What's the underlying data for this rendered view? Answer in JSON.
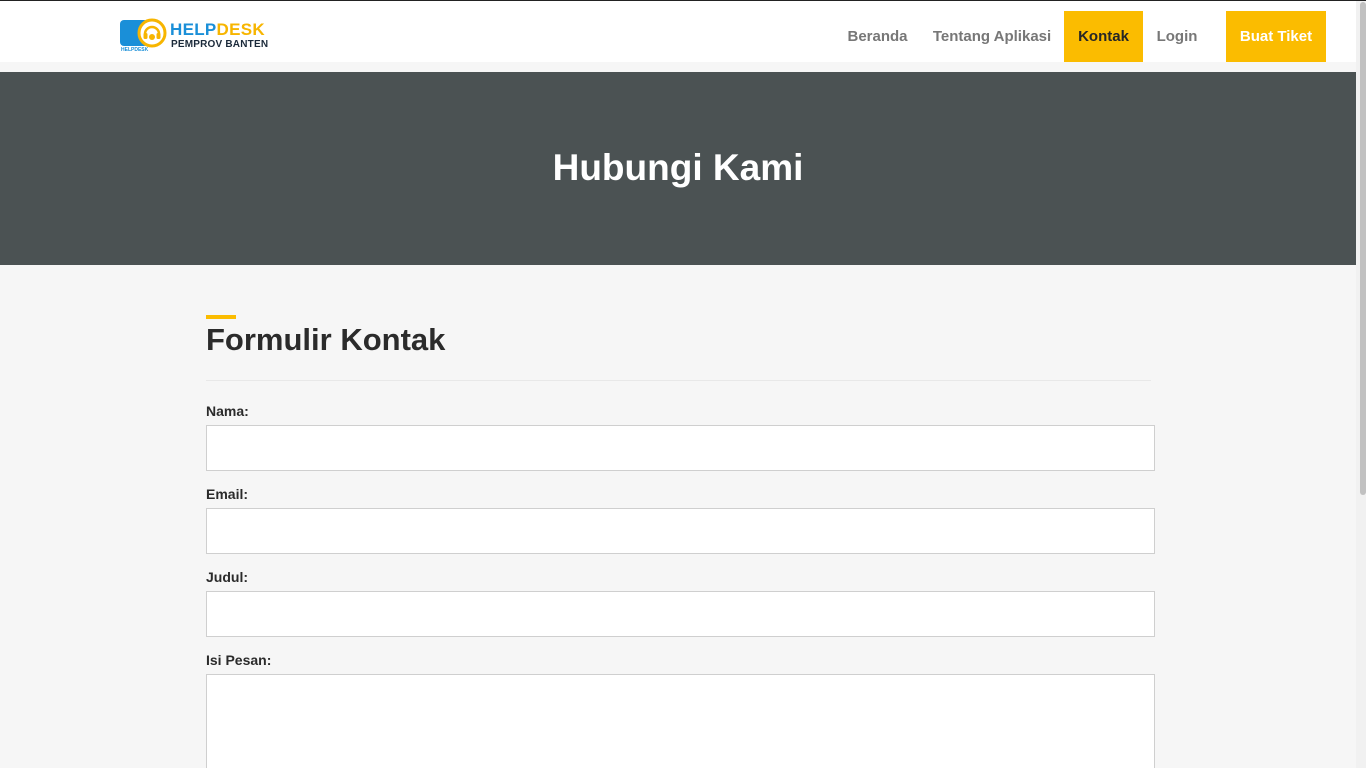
{
  "logo": {
    "title_help": "HELP",
    "title_desk": "DESK",
    "subtitle": "PEMPROV BANTEN",
    "mini_text": "HELPDESK",
    "icon": "headset-icon"
  },
  "nav": {
    "items": [
      {
        "label": "Beranda"
      },
      {
        "label": "Tentang Aplikasi"
      },
      {
        "label": "Kontak",
        "active": true
      },
      {
        "label": "Login"
      }
    ],
    "cta_label": "Buat Tiket"
  },
  "hero": {
    "title": "Hubungi Kami"
  },
  "form": {
    "title": "Formulir Kontak",
    "fields": [
      {
        "label": "Nama:",
        "value": "",
        "placeholder": ""
      },
      {
        "label": "Email:",
        "value": "",
        "placeholder": ""
      },
      {
        "label": "Judul:",
        "value": "",
        "placeholder": ""
      },
      {
        "label": "Isi Pesan:",
        "value": "",
        "placeholder": ""
      }
    ]
  },
  "colors": {
    "accent": "#fbbc00",
    "hero_bg": "#4b5253",
    "logo_blue": "#1a8fd8"
  }
}
